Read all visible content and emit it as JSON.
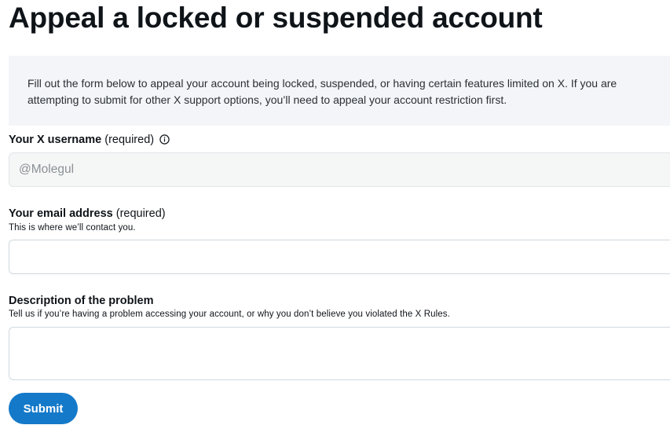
{
  "page": {
    "title": "Appeal a locked or suspended account"
  },
  "notice": {
    "text": "Fill out the form below to appeal your account being locked, suspended, or having certain features limited on X. If you are attempting to submit for other X support options, you’ll need to appeal your account restriction first."
  },
  "form": {
    "username": {
      "label": "Your X username",
      "required_text": "(required)",
      "info_icon": "info-circle-icon",
      "value": "@Molegul"
    },
    "email": {
      "label": "Your email address",
      "required_text": "(required)",
      "help": "This is where we’ll contact you.",
      "value": ""
    },
    "description": {
      "label": "Description of the problem",
      "help": "Tell us if you’re having a problem accessing your account, or why you don’t believe you violated the X Rules.",
      "value": ""
    },
    "submit_label": "Submit"
  },
  "colors": {
    "accent": "#1479c9",
    "notice_bg": "#f3f5f8",
    "readonly_bg": "#f5f6f6",
    "border": "#cfd9de"
  }
}
